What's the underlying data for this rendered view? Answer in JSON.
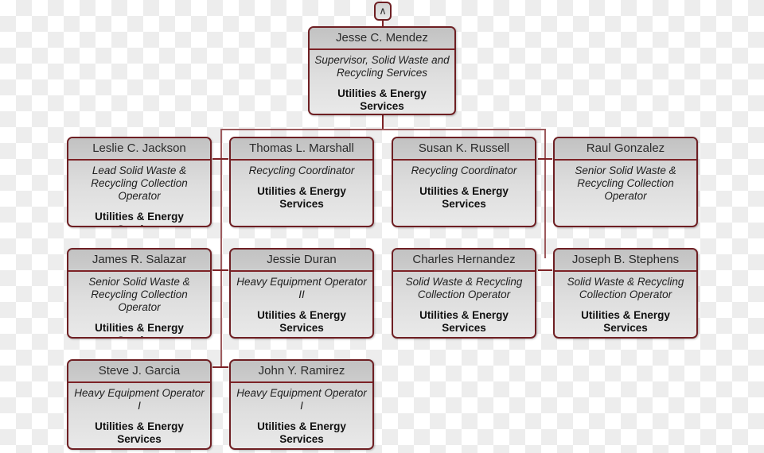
{
  "chart": {
    "kind": "organization-chart",
    "colors": {
      "border": "#6e1f23",
      "connector": "#7d2226",
      "header_text": "#2b2b2b",
      "title_text": "#1f1f1f",
      "dept_text": "#111111"
    },
    "toggle": {
      "icon": "chevron-up-icon",
      "glyph": "∧",
      "label": "Collapse parent"
    },
    "root": {
      "name": "Jesse C. Mendez",
      "title": "Supervisor, Solid Waste and Recycling Services",
      "department": "Utilities & Energy Services"
    },
    "nodes": [
      {
        "name": "Leslie C. Jackson",
        "title": "Lead Solid Waste & Recycling Collection Operator",
        "department": "Utilities & Energy Services"
      },
      {
        "name": "Thomas L. Marshall",
        "title": "Recycling Coordinator",
        "department": "Utilities & Energy Services"
      },
      {
        "name": "Susan K. Russell",
        "title": "Recycling Coordinator",
        "department": "Utilities & Energy Services"
      },
      {
        "name": "Raul Gonzalez",
        "title": "Senior Solid Waste & Recycling Collection Operator",
        "department": ""
      },
      {
        "name": "James R. Salazar",
        "title": "Senior Solid Waste & Recycling Collection Operator",
        "department": "Utilities & Energy Services"
      },
      {
        "name": "Jessie Duran",
        "title": "Heavy Equipment Operator II",
        "department": "Utilities & Energy Services"
      },
      {
        "name": "Charles Hernandez",
        "title": "Solid Waste & Recycling Collection Operator",
        "department": "Utilities & Energy Services"
      },
      {
        "name": "Joseph B. Stephens",
        "title": "Solid Waste & Recycling Collection Operator",
        "department": "Utilities & Energy Services"
      },
      {
        "name": "Steve J. Garcia",
        "title": "Heavy Equipment Operator I",
        "department": "Utilities & Energy Services"
      },
      {
        "name": "John Y. Ramirez",
        "title": "Heavy Equipment Operator I",
        "department": "Utilities & Energy Services"
      }
    ]
  }
}
